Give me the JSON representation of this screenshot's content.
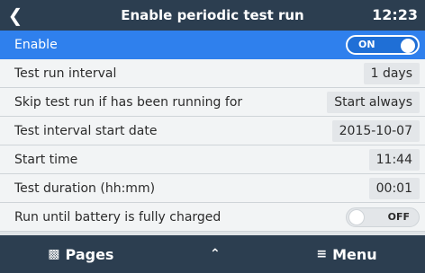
{
  "header": {
    "back_icon": "back-chevron-icon",
    "title": "Enable periodic test run",
    "time": "12:23"
  },
  "rows": [
    {
      "label": "Enable",
      "toggle": "ON",
      "selected": true
    },
    {
      "label": "Test run interval",
      "value": "1 days"
    },
    {
      "label": "Skip test run if has been running for",
      "value": "Start always"
    },
    {
      "label": "Test interval start date",
      "value": "2015-10-07"
    },
    {
      "label": "Start time",
      "value": "11:44"
    },
    {
      "label": "Test duration (hh:mm)",
      "value": "00:01"
    },
    {
      "label": "Run until battery is fully charged",
      "toggle": "OFF"
    }
  ],
  "footer": {
    "pages_label": "Pages",
    "pages_icon": "bar-chart-icon",
    "up_icon": "chevron-up-icon",
    "menu_label": "Menu",
    "menu_icon": "menu-icon"
  },
  "colors": {
    "header_bg": "#2c3e50",
    "selected_row": "#2f80ed",
    "toggle_on": "#1f6fd6"
  }
}
